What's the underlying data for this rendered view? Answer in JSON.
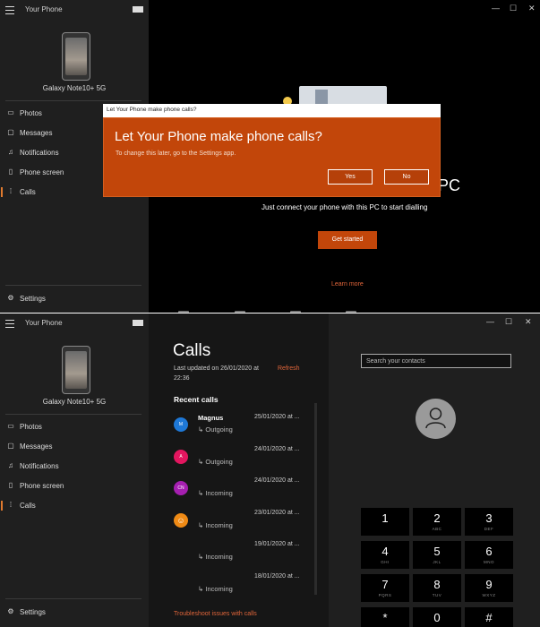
{
  "app": {
    "title": "Your Phone",
    "device_name": "Galaxy Note10+ 5G"
  },
  "nav": {
    "photos": "Photos",
    "messages": "Messages",
    "notifications": "Notifications",
    "phone_screen": "Phone screen",
    "calls": "Calls",
    "settings": "Settings"
  },
  "top": {
    "dialog": {
      "titlebar": "Let Your Phone make phone calls?",
      "heading": "Let Your Phone make phone calls?",
      "subtext": "To change this later, go to the Settings app.",
      "yes": "Yes",
      "no": "No"
    },
    "heading_fragment": "r PC",
    "subtitle": "Just connect your phone with this PC to start dialling",
    "get_started": "Get started",
    "learn_more": "Learn more"
  },
  "calls": {
    "title": "Calls",
    "last_updated": "Last updated on 26/01/2020 at",
    "last_updated_time": "22:36",
    "refresh": "Refresh",
    "recent_heading": "Recent calls",
    "troubleshoot": "Troubleshoot issues with calls",
    "items": [
      {
        "name": "Magnus",
        "type": "Outgoing",
        "date": "25/01/2020 at ...",
        "avatar": "M",
        "color": "#1e78d7"
      },
      {
        "name": "",
        "type": "Outgoing",
        "date": "24/01/2020 at ...",
        "avatar": "A",
        "color": "#e3165f"
      },
      {
        "name": "",
        "type": "Incoming",
        "date": "24/01/2020 at ...",
        "avatar": "CN",
        "color": "#a51fb0"
      },
      {
        "name": "",
        "type": "Incoming",
        "date": "23/01/2020 at ...",
        "avatar": "person-icon",
        "color": "#ef8a15"
      },
      {
        "name": "",
        "type": "Incoming",
        "date": "19/01/2020 at ...",
        "avatar": "",
        "color": ""
      },
      {
        "name": "",
        "type": "Incoming",
        "date": "18/01/2020 at ...",
        "avatar": "",
        "color": ""
      }
    ]
  },
  "dialer": {
    "search_placeholder": "Search your contacts",
    "keys": [
      {
        "digit": "1",
        "letters": ""
      },
      {
        "digit": "2",
        "letters": "ABC"
      },
      {
        "digit": "3",
        "letters": "DEF"
      },
      {
        "digit": "4",
        "letters": "GHI"
      },
      {
        "digit": "5",
        "letters": "JKL"
      },
      {
        "digit": "6",
        "letters": "MNO"
      },
      {
        "digit": "7",
        "letters": "PQRS"
      },
      {
        "digit": "8",
        "letters": "TUV"
      },
      {
        "digit": "9",
        "letters": "WXYZ"
      },
      {
        "digit": "*",
        "letters": ""
      },
      {
        "digit": "0",
        "letters": ""
      },
      {
        "digit": "#",
        "letters": ""
      }
    ]
  },
  "colors": {
    "accent": "#c2460a",
    "link": "#e0653a",
    "sidebar_bg": "#1f1f1f"
  }
}
